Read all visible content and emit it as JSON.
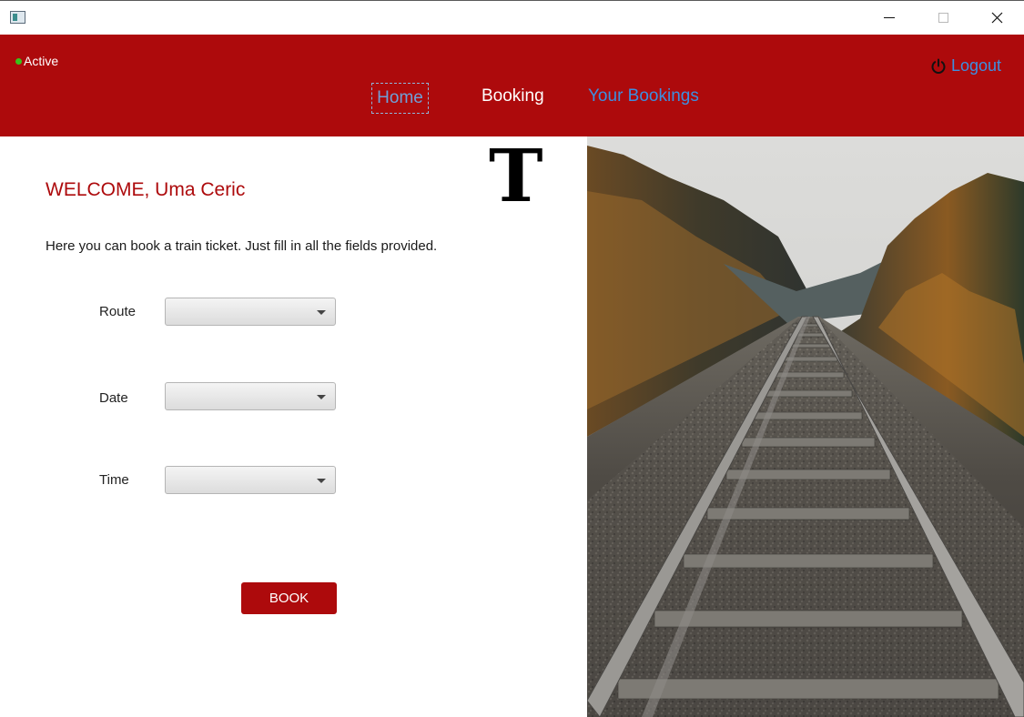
{
  "window": {
    "icons": {
      "app": "app-window-icon",
      "minimize": "minimize-icon",
      "maximize": "maximize-icon",
      "close": "close-icon"
    }
  },
  "header": {
    "status_label": "Active",
    "status_color": "#39c21b",
    "brand_color": "#ad0a0c",
    "logout_label": "Logout",
    "logout_icon": "power-icon",
    "nav": {
      "home": "Home",
      "booking": "Booking",
      "your_bookings": "Your Bookings"
    }
  },
  "main": {
    "logo_letter": "T",
    "welcome": "WELCOME,  Uma Ceric",
    "intro": "Here you can book a train ticket. Just fill in all the fields provided.",
    "fields": {
      "route_label": "Route",
      "date_label": "Date",
      "time_label": "Time"
    },
    "book_label": "BOOK"
  },
  "photo": {
    "subject": "railway-tracks-photo"
  }
}
